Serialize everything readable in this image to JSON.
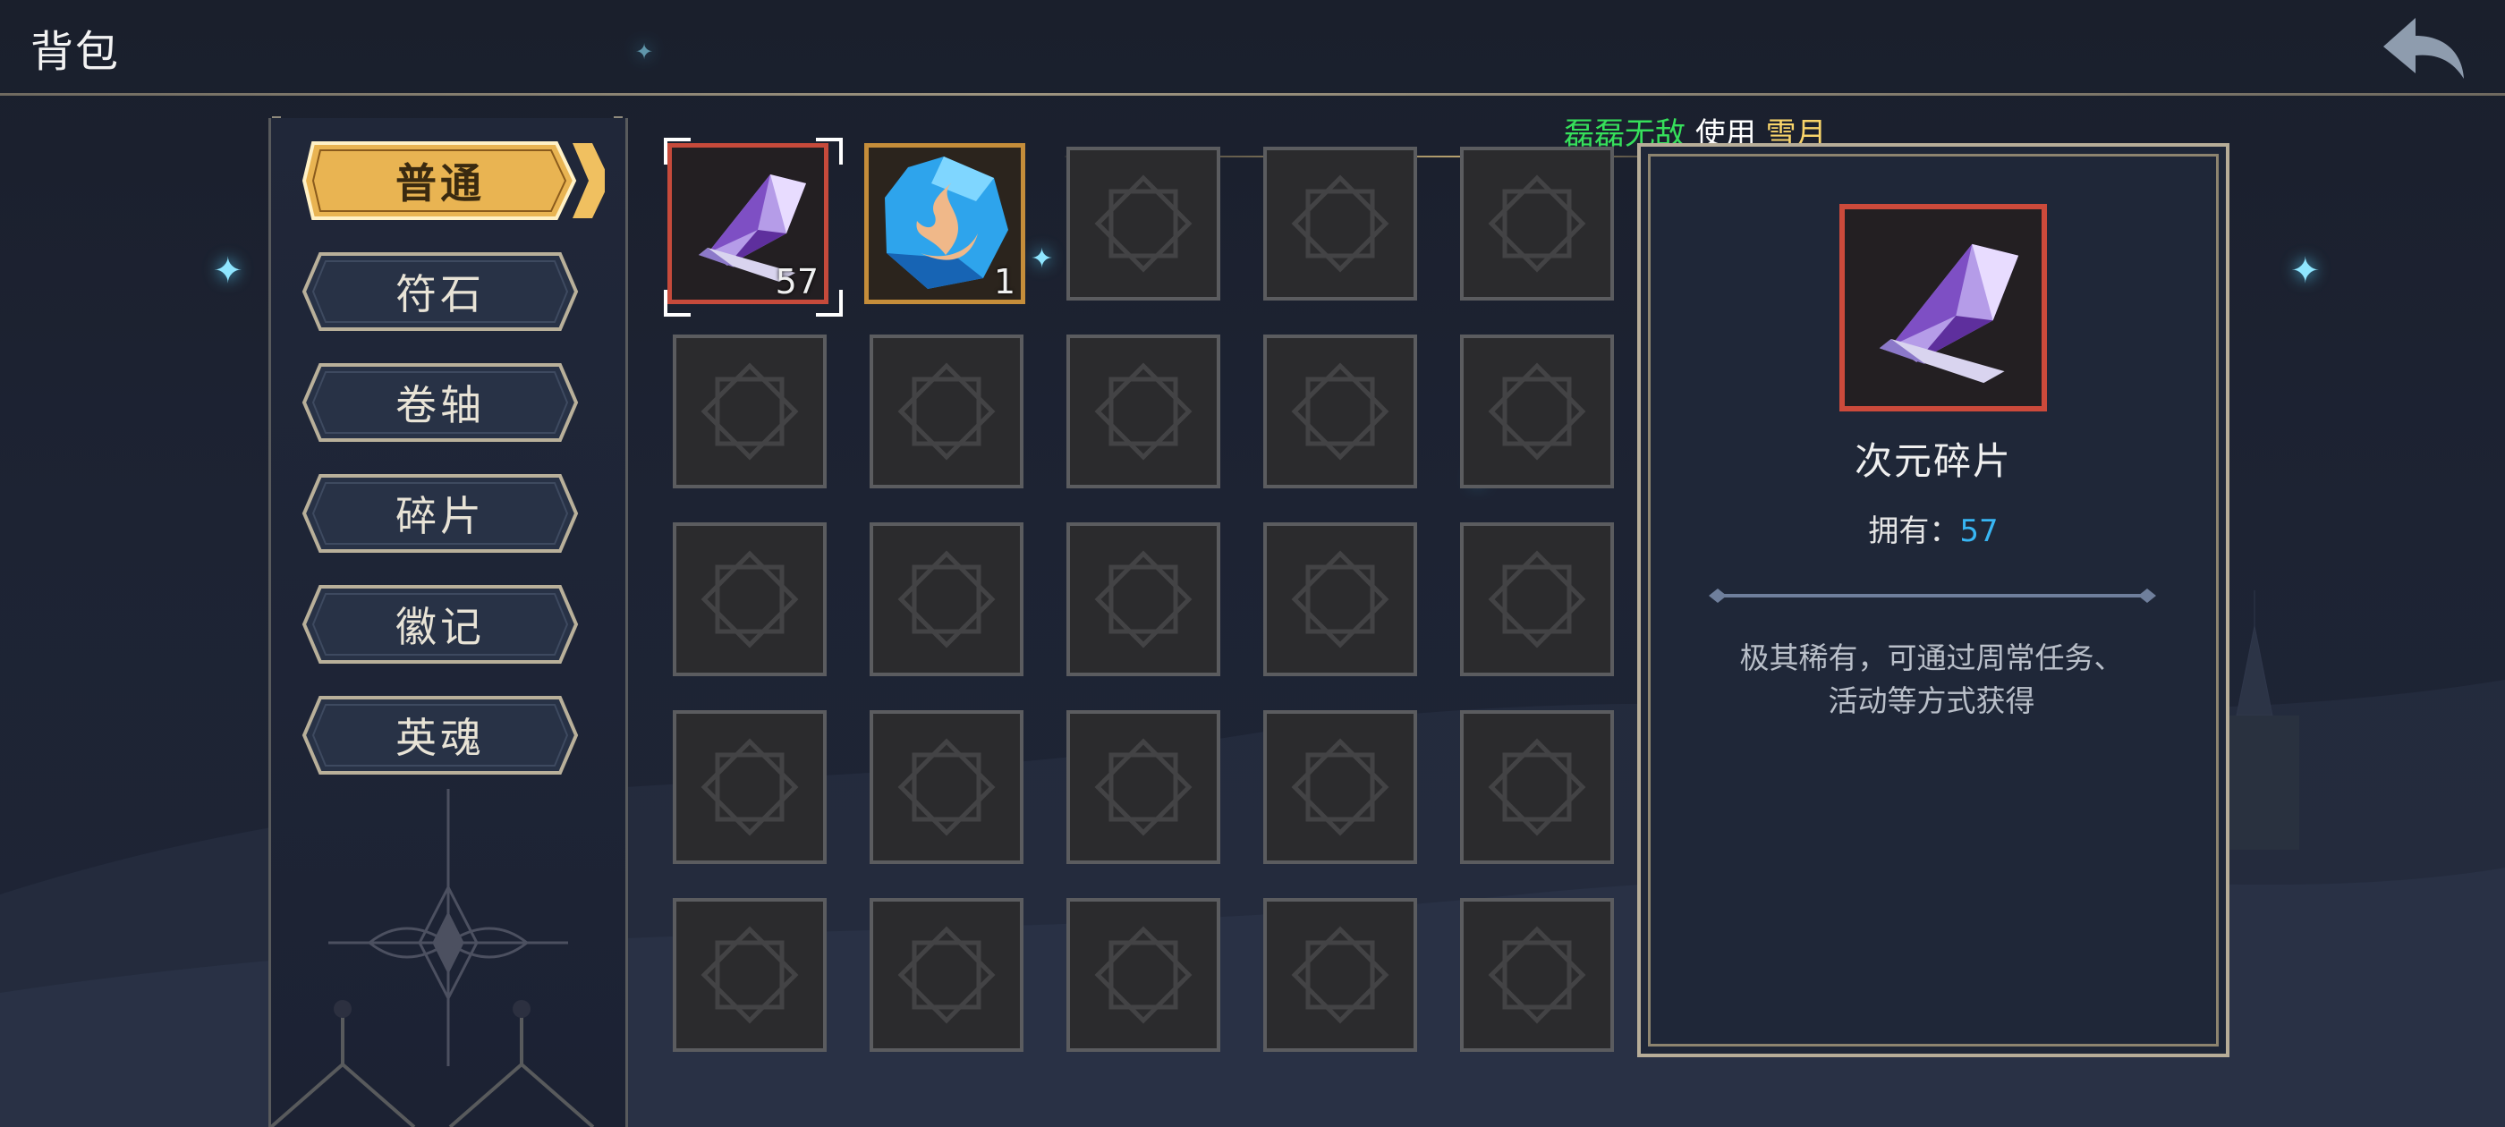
{
  "header": {
    "title": "背包",
    "back_icon": "back-arrow-icon"
  },
  "notice": {
    "user": "磊磊无敌",
    "action": "使用",
    "item": "雪月"
  },
  "categories": [
    {
      "label": "普通",
      "active": true
    },
    {
      "label": "符石",
      "active": false
    },
    {
      "label": "卷轴",
      "active": false
    },
    {
      "label": "碎片",
      "active": false
    },
    {
      "label": "徽记",
      "active": false
    },
    {
      "label": "英魂",
      "active": false
    }
  ],
  "inventory": {
    "items": [
      {
        "icon": "crystal-shard-icon",
        "count": "57",
        "selected": true,
        "rarity_color": "#c64a3b"
      },
      {
        "icon": "blue-flame-stone-icon",
        "count": "1",
        "selected": false,
        "rarity_color": "#c58d3a"
      }
    ]
  },
  "detail": {
    "icon": "crystal-shard-icon",
    "name": "次元碎片",
    "own_label": "拥有：",
    "own_count": "57",
    "description_line1": "极其稀有，可通过周常任务、",
    "description_line2": "活动等方式获得"
  },
  "colors": {
    "accent_gold": "#f0c060",
    "own_count_blue": "#38b6f4",
    "notice_user_green": "#36e05b",
    "notice_item_yellow": "#f8d46a"
  }
}
